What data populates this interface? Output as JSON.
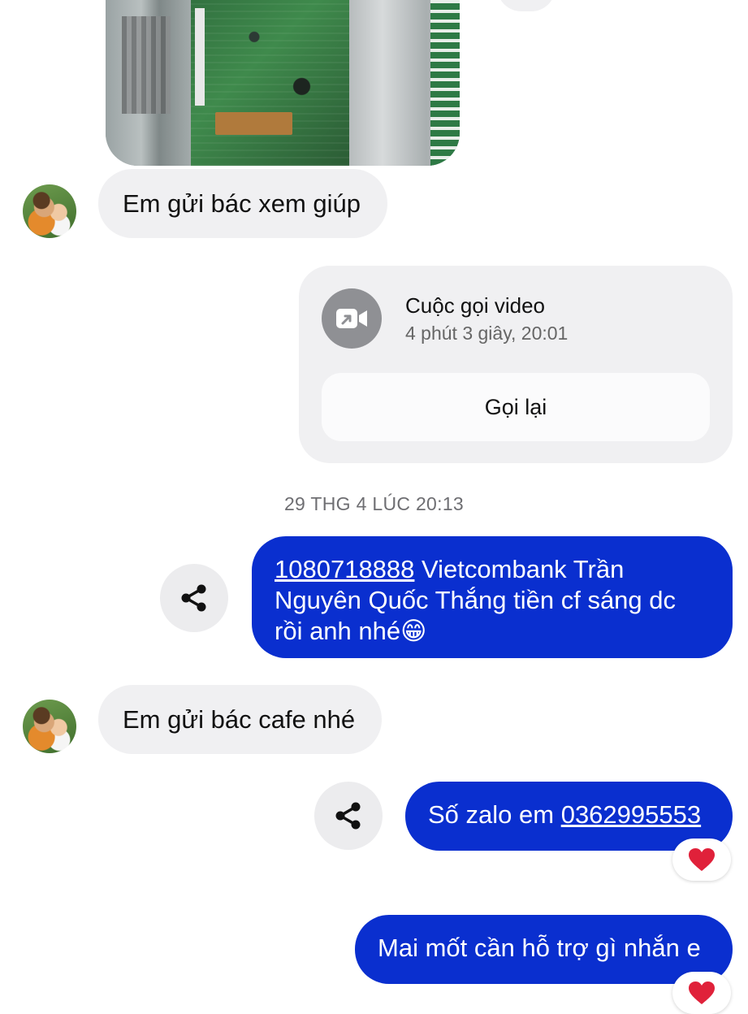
{
  "messages": {
    "incoming_1": "Em gửi bác xem giúp",
    "call": {
      "title": "Cuộc gọi video",
      "detail": "4 phút 3 giây, 20:01",
      "callback_label": "Gọi lại"
    },
    "timestamp": "29 THG 4 LÚC 20:13",
    "outgoing_1": {
      "account_number": "1080718888",
      "text": " Vietcombank Trần Nguyên Quốc Thắng tiền cf sáng dc rồi anh nhé😁"
    },
    "incoming_2": "Em gửi bác cafe nhé",
    "outgoing_2": {
      "prefix": "Số zalo em ",
      "phone": "0362995553",
      "reaction": "❤️"
    },
    "outgoing_3": {
      "text": "Mai mốt cần hỗ trợ gì nhắn e",
      "reaction": "❤️"
    }
  },
  "colors": {
    "outgoing_bubble": "#0a2fcf",
    "incoming_bubble": "#f0f0f2",
    "reaction_heart": "#e0213a"
  },
  "icons": {
    "call": "video-call-icon",
    "share": "share-icon",
    "reaction": "heart-icon"
  }
}
